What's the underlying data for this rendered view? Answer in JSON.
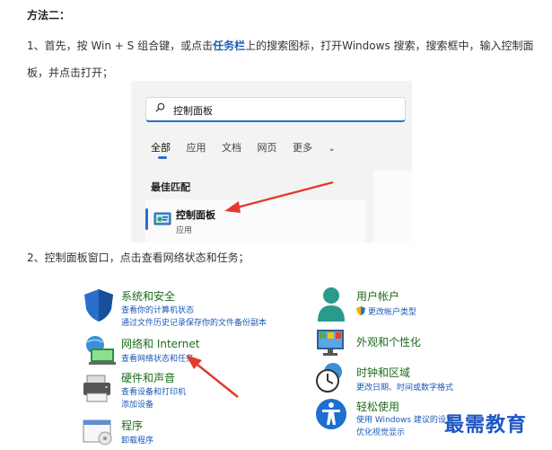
{
  "article": {
    "heading": "方法二：",
    "step1_prefix": "1、首先，按 Win + S 组合键，或点击",
    "step1_highlight": "任务栏",
    "step1_suffix": "上的搜索图标，打开Windows 搜索，搜索框中，输入控制面板，并点击打开；",
    "step2": "2、控制面板窗口，点击查看网络状态和任务；"
  },
  "search_window": {
    "query": "控制面板",
    "tabs": [
      "全部",
      "应用",
      "文档",
      "网页",
      "更多"
    ],
    "more_chevron": "⌄",
    "best_match_label": "最佳匹配",
    "result_name": "控制面板",
    "result_type": "应用"
  },
  "control_panel": {
    "system_security": {
      "title": "系统和安全",
      "links": [
        "查看你的计算机状态",
        "通过文件历史记录保存你的文件备份副本"
      ]
    },
    "network": {
      "title": "网络和 Internet",
      "links": [
        "查看网络状态和任务"
      ]
    },
    "hardware": {
      "title": "硬件和声音",
      "links": [
        "查看设备和打印机",
        "添加设备"
      ]
    },
    "programs": {
      "title": "程序",
      "links": [
        "卸载程序"
      ]
    },
    "user_accounts": {
      "title": "用户帐户",
      "links": [
        "更改帐户类型"
      ]
    },
    "appearance": {
      "title": "外观和个性化",
      "links": []
    },
    "clock_region": {
      "title": "时钟和区域",
      "links": [
        "更改日期、时间或数字格式"
      ]
    },
    "ease_of_access": {
      "title": "轻松使用",
      "links": [
        "使用 Windows 建议的设置",
        "优化视觉显示"
      ]
    }
  },
  "watermark": "最需教育",
  "colors": {
    "accent": "#2a6fc9",
    "link": "#1a58b8",
    "category": "#1e6b1e",
    "arrow": "#e23b2e",
    "watermark": "#1d56c5"
  }
}
